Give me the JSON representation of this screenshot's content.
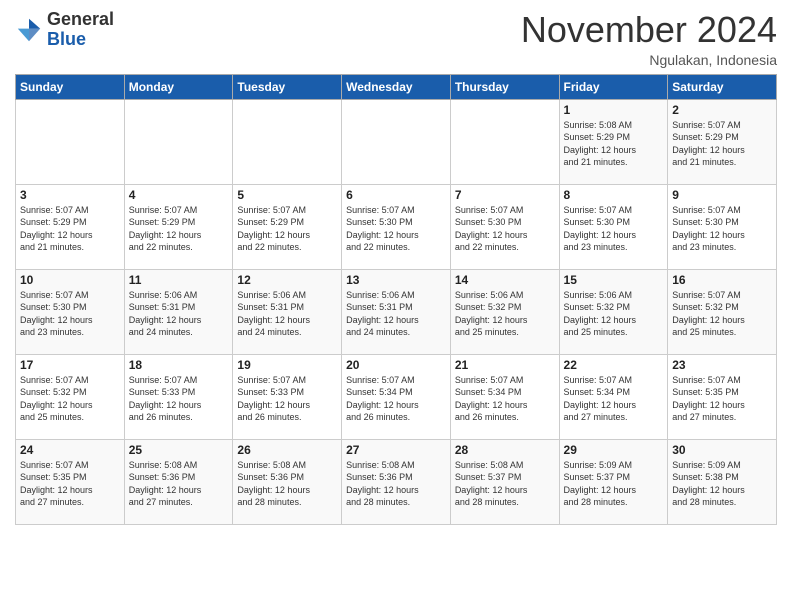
{
  "header": {
    "logo_general": "General",
    "logo_blue": "Blue",
    "month_title": "November 2024",
    "location": "Ngulakan, Indonesia"
  },
  "weekdays": [
    "Sunday",
    "Monday",
    "Tuesday",
    "Wednesday",
    "Thursday",
    "Friday",
    "Saturday"
  ],
  "weeks": [
    [
      {
        "day": "",
        "info": ""
      },
      {
        "day": "",
        "info": ""
      },
      {
        "day": "",
        "info": ""
      },
      {
        "day": "",
        "info": ""
      },
      {
        "day": "",
        "info": ""
      },
      {
        "day": "1",
        "info": "Sunrise: 5:08 AM\nSunset: 5:29 PM\nDaylight: 12 hours\nand 21 minutes."
      },
      {
        "day": "2",
        "info": "Sunrise: 5:07 AM\nSunset: 5:29 PM\nDaylight: 12 hours\nand 21 minutes."
      }
    ],
    [
      {
        "day": "3",
        "info": "Sunrise: 5:07 AM\nSunset: 5:29 PM\nDaylight: 12 hours\nand 21 minutes."
      },
      {
        "day": "4",
        "info": "Sunrise: 5:07 AM\nSunset: 5:29 PM\nDaylight: 12 hours\nand 22 minutes."
      },
      {
        "day": "5",
        "info": "Sunrise: 5:07 AM\nSunset: 5:29 PM\nDaylight: 12 hours\nand 22 minutes."
      },
      {
        "day": "6",
        "info": "Sunrise: 5:07 AM\nSunset: 5:30 PM\nDaylight: 12 hours\nand 22 minutes."
      },
      {
        "day": "7",
        "info": "Sunrise: 5:07 AM\nSunset: 5:30 PM\nDaylight: 12 hours\nand 22 minutes."
      },
      {
        "day": "8",
        "info": "Sunrise: 5:07 AM\nSunset: 5:30 PM\nDaylight: 12 hours\nand 23 minutes."
      },
      {
        "day": "9",
        "info": "Sunrise: 5:07 AM\nSunset: 5:30 PM\nDaylight: 12 hours\nand 23 minutes."
      }
    ],
    [
      {
        "day": "10",
        "info": "Sunrise: 5:07 AM\nSunset: 5:30 PM\nDaylight: 12 hours\nand 23 minutes."
      },
      {
        "day": "11",
        "info": "Sunrise: 5:06 AM\nSunset: 5:31 PM\nDaylight: 12 hours\nand 24 minutes."
      },
      {
        "day": "12",
        "info": "Sunrise: 5:06 AM\nSunset: 5:31 PM\nDaylight: 12 hours\nand 24 minutes."
      },
      {
        "day": "13",
        "info": "Sunrise: 5:06 AM\nSunset: 5:31 PM\nDaylight: 12 hours\nand 24 minutes."
      },
      {
        "day": "14",
        "info": "Sunrise: 5:06 AM\nSunset: 5:32 PM\nDaylight: 12 hours\nand 25 minutes."
      },
      {
        "day": "15",
        "info": "Sunrise: 5:06 AM\nSunset: 5:32 PM\nDaylight: 12 hours\nand 25 minutes."
      },
      {
        "day": "16",
        "info": "Sunrise: 5:07 AM\nSunset: 5:32 PM\nDaylight: 12 hours\nand 25 minutes."
      }
    ],
    [
      {
        "day": "17",
        "info": "Sunrise: 5:07 AM\nSunset: 5:32 PM\nDaylight: 12 hours\nand 25 minutes."
      },
      {
        "day": "18",
        "info": "Sunrise: 5:07 AM\nSunset: 5:33 PM\nDaylight: 12 hours\nand 26 minutes."
      },
      {
        "day": "19",
        "info": "Sunrise: 5:07 AM\nSunset: 5:33 PM\nDaylight: 12 hours\nand 26 minutes."
      },
      {
        "day": "20",
        "info": "Sunrise: 5:07 AM\nSunset: 5:34 PM\nDaylight: 12 hours\nand 26 minutes."
      },
      {
        "day": "21",
        "info": "Sunrise: 5:07 AM\nSunset: 5:34 PM\nDaylight: 12 hours\nand 26 minutes."
      },
      {
        "day": "22",
        "info": "Sunrise: 5:07 AM\nSunset: 5:34 PM\nDaylight: 12 hours\nand 27 minutes."
      },
      {
        "day": "23",
        "info": "Sunrise: 5:07 AM\nSunset: 5:35 PM\nDaylight: 12 hours\nand 27 minutes."
      }
    ],
    [
      {
        "day": "24",
        "info": "Sunrise: 5:07 AM\nSunset: 5:35 PM\nDaylight: 12 hours\nand 27 minutes."
      },
      {
        "day": "25",
        "info": "Sunrise: 5:08 AM\nSunset: 5:36 PM\nDaylight: 12 hours\nand 27 minutes."
      },
      {
        "day": "26",
        "info": "Sunrise: 5:08 AM\nSunset: 5:36 PM\nDaylight: 12 hours\nand 28 minutes."
      },
      {
        "day": "27",
        "info": "Sunrise: 5:08 AM\nSunset: 5:36 PM\nDaylight: 12 hours\nand 28 minutes."
      },
      {
        "day": "28",
        "info": "Sunrise: 5:08 AM\nSunset: 5:37 PM\nDaylight: 12 hours\nand 28 minutes."
      },
      {
        "day": "29",
        "info": "Sunrise: 5:09 AM\nSunset: 5:37 PM\nDaylight: 12 hours\nand 28 minutes."
      },
      {
        "day": "30",
        "info": "Sunrise: 5:09 AM\nSunset: 5:38 PM\nDaylight: 12 hours\nand 28 minutes."
      }
    ]
  ]
}
